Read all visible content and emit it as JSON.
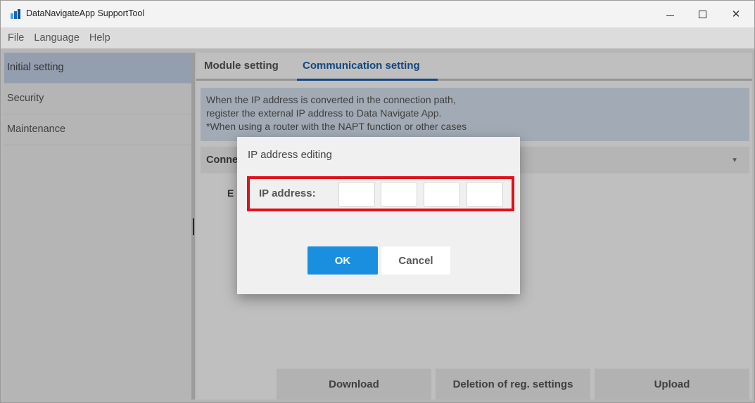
{
  "window": {
    "title": "DataNavigateApp SupportTool",
    "icon": "app-logo-icon",
    "controls": {
      "minimize": "—",
      "maximize": "□",
      "close": "✕"
    }
  },
  "menubar": {
    "items": [
      {
        "label": "File"
      },
      {
        "label": "Language"
      },
      {
        "label": "Help"
      }
    ]
  },
  "sidebar": {
    "items": [
      {
        "label": "Initial setting",
        "active": true
      },
      {
        "label": "Security",
        "active": false
      },
      {
        "label": "Maintenance",
        "active": false
      }
    ]
  },
  "main": {
    "tabs": [
      {
        "label": "Module setting",
        "active": false
      },
      {
        "label": "Communication setting",
        "active": true
      }
    ],
    "info_text": "When the IP address is converted in the connection path,\nregister the external IP address to Data Navigate App.\n*When using a router with the NAPT function or other cases",
    "connection_label_partial": "Conne",
    "external_label_partial": "E",
    "buttons": {
      "download": "Download",
      "delete": "Deletion of reg. settings",
      "upload": "Upload"
    }
  },
  "dialog": {
    "title": "IP address editing",
    "ip_label": "IP address:",
    "octets": [
      "",
      "",
      "",
      ""
    ],
    "ok_label": "OK",
    "cancel_label": "Cancel"
  },
  "colors": {
    "accent": "#1a8fe0",
    "tab_active": "#1a5fa8",
    "highlight_border": "#e0121b",
    "sidebar_active": "#c4d3ea",
    "info_bg": "#d9e4f2"
  }
}
